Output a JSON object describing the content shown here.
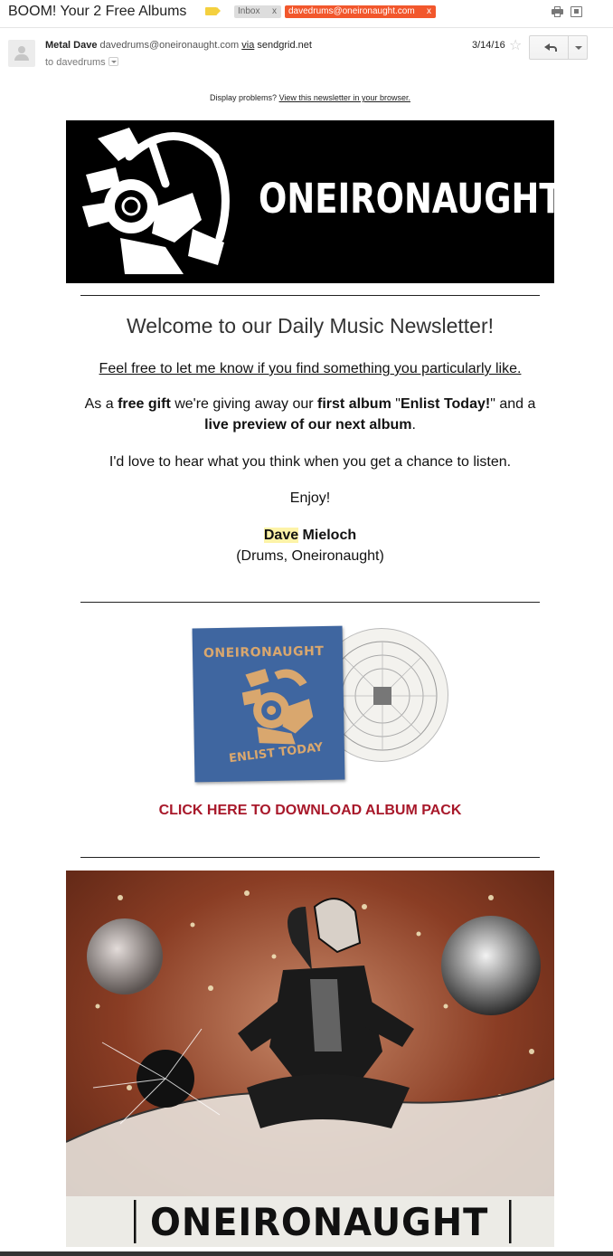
{
  "email": {
    "subject": "BOOM! Your 2 Free Albums",
    "labels": [
      {
        "text": "Inbox",
        "close": "x"
      },
      {
        "text": "davedrums@oneironaught.com",
        "close": "x"
      }
    ],
    "sender_name": "Metal Dave",
    "sender_email": "davedrums@oneironaught.com",
    "via_label": "via",
    "via_domain": "sendgrid.net",
    "to_line": "to davedrums",
    "date": "3/14/16",
    "colors": {
      "important": "#f4d03f",
      "label_accent": "#f2572c"
    }
  },
  "newsletter": {
    "display_problems_prefix": "Display problems?",
    "display_problems_link": "View this newsletter in your browser.",
    "banner_brand": "ONEIRONAUGHT",
    "heading": "Welcome to our Daily Music Newsletter!",
    "feel_free": "Feel free to let me know if you find something you particularly like.",
    "gift": {
      "t1": "As a ",
      "b1": "free gift",
      "t2": " we're giving away our ",
      "b2": "first album",
      "t3": " \"",
      "b3": "Enlist Today!",
      "t4": "\" and a",
      "b4": "live preview of our next album",
      "t5": "."
    },
    "hear": "I'd love to hear what you think when you get a chance to listen.",
    "enjoy": "Enjoy!",
    "sig_first": "Dave",
    "sig_last": " Mieloch",
    "sig_role": "(Drums, Oneironaught)",
    "album_cover_title": "ONEIRONAUGHT",
    "album_cover_subtitle": "ENLIST TODAY",
    "download_cta": "CLICK HERE TO DOWNLOAD ALBUM PACK",
    "art_brand": "ONEIRONAUGHT",
    "colors": {
      "cta": "#a8182a",
      "highlight": "#fdf3a8",
      "cover_blue": "#3f66a0"
    }
  }
}
